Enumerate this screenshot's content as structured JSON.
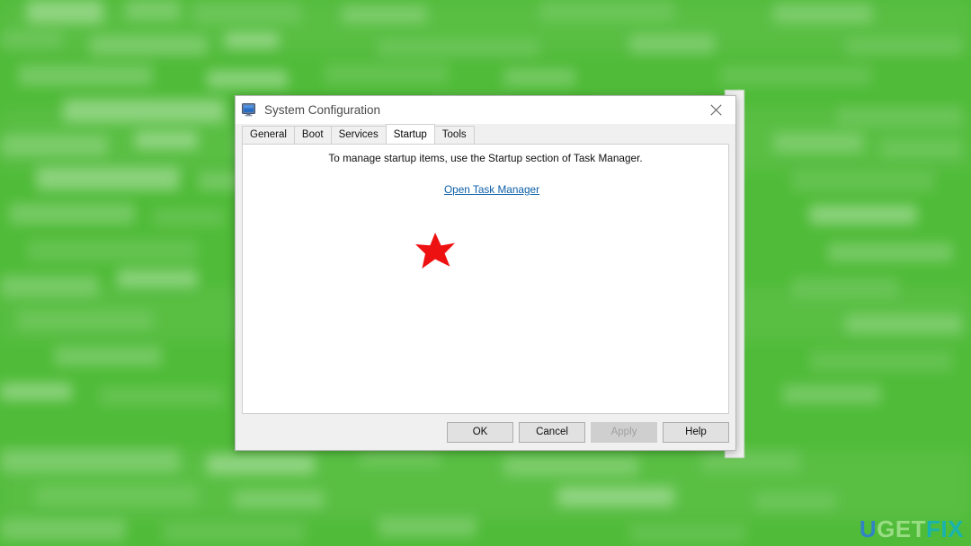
{
  "desktop": {
    "background_color": "#4fbb38",
    "description": "blurred green desktop background"
  },
  "watermark": {
    "part1": "U",
    "part2": "GET",
    "part3": "FIX",
    "full": "UGETFIX",
    "color_u": "#2f7fd0",
    "color_get": "#9fe08a",
    "color_fix": "#15b3b8"
  },
  "dialog": {
    "title": "System Configuration",
    "icon": "system-configuration-monitor-icon",
    "close_label": "Close",
    "tabs": [
      {
        "label": "General",
        "selected": false
      },
      {
        "label": "Boot",
        "selected": false
      },
      {
        "label": "Services",
        "selected": false
      },
      {
        "label": "Startup",
        "selected": true
      },
      {
        "label": "Tools",
        "selected": false
      }
    ],
    "content": {
      "instruction": "To manage startup items, use the Startup section of Task Manager.",
      "link_label": "Open Task Manager",
      "link_color": "#0b5fa8",
      "annotation": {
        "shape": "star",
        "color": "#ee1111"
      }
    },
    "buttons": [
      {
        "label": "OK",
        "disabled": false
      },
      {
        "label": "Cancel",
        "disabled": false
      },
      {
        "label": "Apply",
        "disabled": true
      },
      {
        "label": "Help",
        "disabled": false
      }
    ]
  }
}
